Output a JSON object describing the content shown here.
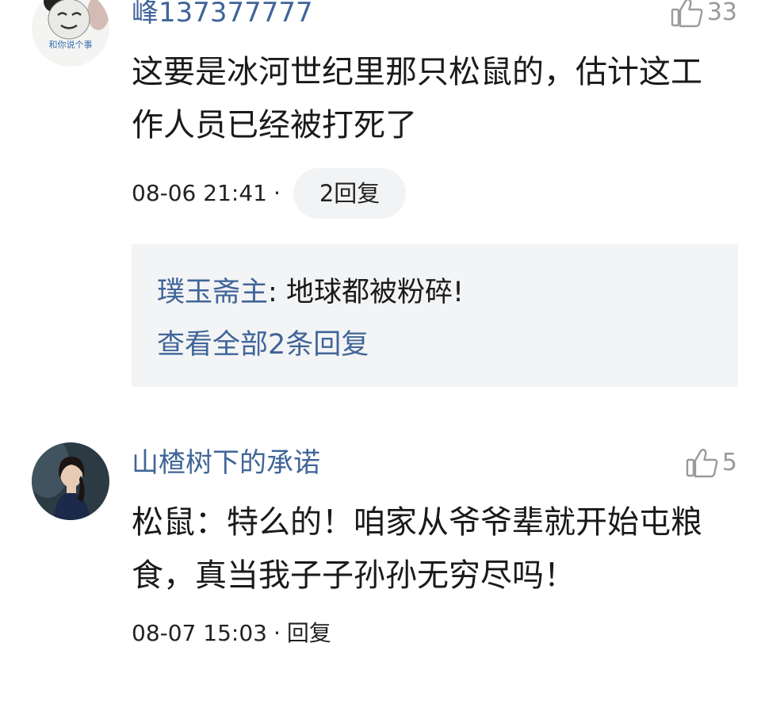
{
  "comments": [
    {
      "username": "峰137377777",
      "likes": "33",
      "text": "这要是冰河世纪里那只松鼠的，估计这工作人员已经被打死了",
      "time": "08-06 21:41",
      "separator": "·",
      "reply_button": "2回复",
      "avatar_caption": "和你说个事",
      "replies": {
        "preview_author": "璞玉斋主",
        "preview_colon": ":",
        "preview_text": " 地球都被粉碎!",
        "view_all": "查看全部2条回复"
      }
    },
    {
      "username": "山楂树下的承诺",
      "likes": "5",
      "text": "松鼠：特么的！咱家从爷爷辈就开始屯粮食，真当我子子孙孙无穷尽吗！",
      "time": "08-07 15:03",
      "separator": "·",
      "reply_button": "回复"
    }
  ],
  "colors": {
    "link_blue": "#406599",
    "reply_bg": "#f3f4f5",
    "pill_bg": "#f2f3f4",
    "muted": "#9a9a9a"
  },
  "icons": {
    "like": "thumbs-up-icon"
  }
}
